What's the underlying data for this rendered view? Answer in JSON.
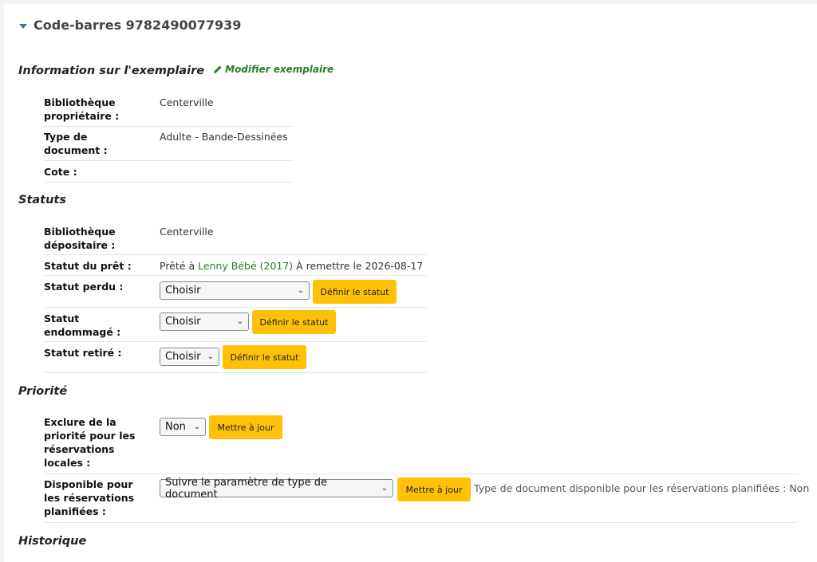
{
  "header": {
    "title": "Code-barres 9782490077939"
  },
  "item_info": {
    "heading": "Information sur l'exemplaire",
    "edit_link": "Modifier exemplaire",
    "rows": [
      {
        "label_lines": [
          "Bibliothèque",
          "propriétaire :"
        ],
        "value": "Centerville"
      },
      {
        "label_lines": [
          "Type de",
          "document :"
        ],
        "value": "Adulte - Bande-Dessinées"
      },
      {
        "label_lines": [
          "Cote :"
        ],
        "value": ""
      }
    ]
  },
  "statuses": {
    "heading": "Statuts",
    "holding_library": {
      "label_lines": [
        "Bibliothèque",
        "dépositaire :"
      ],
      "value": "Centerville"
    },
    "checkout": {
      "label": "Statut du prêt :",
      "prefix": "Prêté à",
      "patron": "Lenny Bébé (2017)",
      "due": "À remettre le 2026-08-17"
    },
    "lost": {
      "label_lines": [
        "Statut perdu :"
      ],
      "selected": "Choisir",
      "button": "Définir le statut"
    },
    "damaged": {
      "label_lines": [
        "Statut",
        "endommagé :"
      ],
      "selected": "Choisir",
      "button": "Définir le statut"
    },
    "withdrawn": {
      "label_lines": [
        "Statut retiré :"
      ],
      "selected": "Choisir",
      "button": "Définir le statut"
    }
  },
  "priority": {
    "heading": "Priorité",
    "exclude_local": {
      "label_lines": [
        "Exclure de la",
        "priorité pour les",
        "réservations",
        "locales :"
      ],
      "selected": "Non",
      "button": "Mettre à jour"
    },
    "bookable": {
      "label_lines": [
        "Disponible pour",
        "les réservations",
        "planifiées :"
      ],
      "selected": "Suivre le paramètre de type de document",
      "button": "Mettre à jour",
      "hint": "Type de document disponible pour les réservations planifiées : Non"
    }
  },
  "history": {
    "heading": "Historique"
  },
  "icons": {
    "caret": "caret-down-icon",
    "edit": "pencil-icon",
    "select": "chevron-down-icon"
  },
  "colors": {
    "accent_button": "#ffc107",
    "link": "#2b7a2b",
    "caret": "#2e7ab8"
  }
}
